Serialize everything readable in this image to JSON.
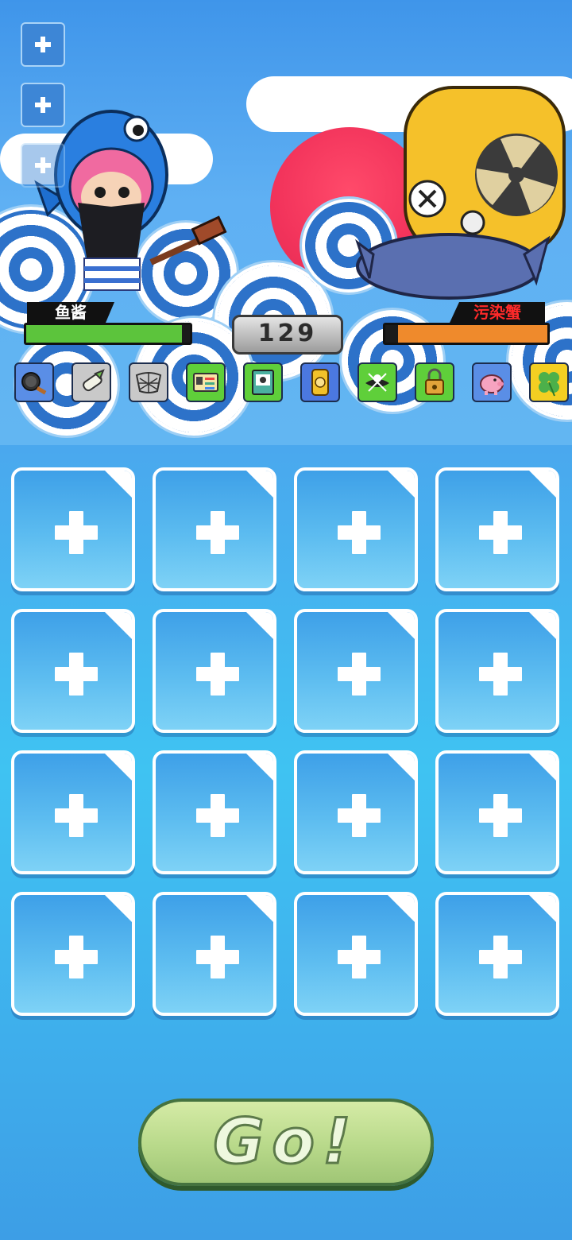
{
  "player": {
    "name": "鱼酱",
    "hp_fraction": 0.95,
    "hp_color": "#5cc43c"
  },
  "enemy": {
    "name": "污染蟹",
    "hp_fraction": 0.92,
    "hp_color": "#ef8a2c",
    "name_color": "#ff2a2a"
  },
  "counter": "129",
  "side_buttons": [
    {
      "icon": "plus-icon",
      "state": "active"
    },
    {
      "icon": "plus-icon",
      "state": "active"
    },
    {
      "icon": "plus-icon",
      "state": "faded"
    }
  ],
  "items": [
    {
      "icon": "frying-pan-icon",
      "color": "#5a8ee6"
    },
    {
      "icon": "leek-icon",
      "color": "#c9c9c9"
    },
    {
      "icon": "net-icon",
      "color": "#c9c9c9"
    },
    {
      "icon": "id-card-icon",
      "color": "#5fcf3a"
    },
    {
      "icon": "book-icon",
      "color": "#5fcf3a"
    },
    {
      "icon": "gold-barrel-icon",
      "color": "#4b78e0"
    },
    {
      "icon": "pirate-flag-icon",
      "color": "#5fcf3a"
    },
    {
      "icon": "padlock-icon",
      "color": "#5fcf3a"
    },
    {
      "icon": "piggy-bank-icon",
      "color": "#5a8ee6"
    },
    {
      "icon": "clover-icon",
      "color": "#f3cf22"
    }
  ],
  "grid": {
    "rows": 4,
    "cols": 4,
    "slot_icon": "plus-icon"
  },
  "go_button": {
    "label": "Go!"
  },
  "colors": {
    "sky": "#4aa6f0",
    "sun": "#f2335b",
    "wave_blue": "#2d72c9"
  }
}
